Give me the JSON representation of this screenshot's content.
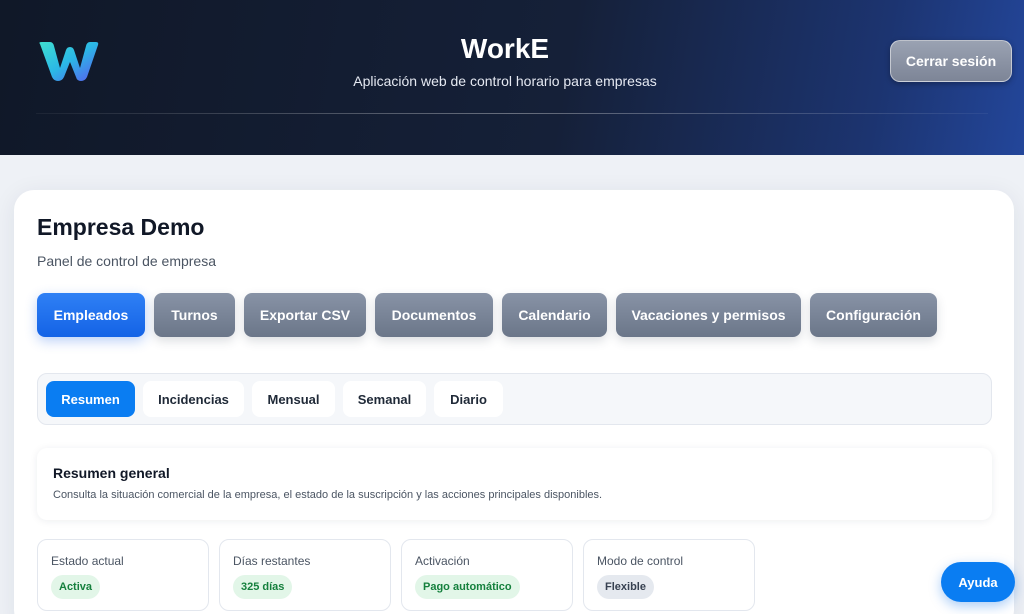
{
  "header": {
    "title": "WorkE",
    "subtitle": "Aplicación web de control horario para empresas",
    "logout_label": "Cerrar sesión"
  },
  "company": {
    "name": "Empresa Demo",
    "subtitle": "Panel de control de empresa"
  },
  "nav": {
    "items": [
      {
        "label": "Empleados",
        "active": true
      },
      {
        "label": "Turnos"
      },
      {
        "label": "Exportar CSV"
      },
      {
        "label": "Documentos"
      },
      {
        "label": "Calendario"
      },
      {
        "label": "Vacaciones y permisos"
      },
      {
        "label": "Configuración"
      }
    ]
  },
  "subtabs": {
    "items": [
      {
        "label": "Resumen",
        "active": true
      },
      {
        "label": "Incidencias"
      },
      {
        "label": "Mensual"
      },
      {
        "label": "Semanal"
      },
      {
        "label": "Diario"
      }
    ]
  },
  "summary": {
    "title": "Resumen general",
    "description": "Consulta la situación comercial de la empresa, el estado de la suscripción y las acciones principales disponibles."
  },
  "stats": [
    {
      "label": "Estado actual",
      "value": "Activa",
      "color": "green"
    },
    {
      "label": "Días restantes",
      "value": "325 días",
      "color": "green"
    },
    {
      "label": "Activación",
      "value": "Pago automático",
      "color": "green"
    },
    {
      "label": "Modo de control",
      "value": "Flexible",
      "color": "gray"
    }
  ],
  "help_label": "Ayuda",
  "colors": {
    "accent": "#0a7df2",
    "nav_active": "#1463e6",
    "nav_inactive": "#7a8497",
    "badge_green_bg": "#e2f6e8",
    "badge_green_text": "#15803d"
  }
}
